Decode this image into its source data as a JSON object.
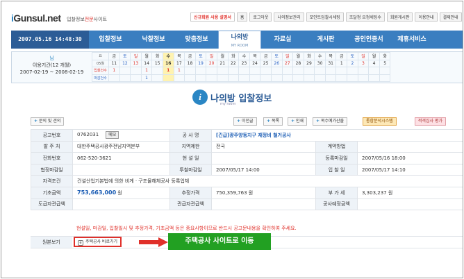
{
  "site": {
    "logo_prefix": "i",
    "logo_main": "Gunsul.net",
    "tagline_pre": "입찰정보",
    "tagline_red": "전문",
    "tagline_post": "사이트"
  },
  "toplinks": [
    "신규회원 사용 설명서",
    "홈",
    "로그아웃",
    "나의정보관리",
    "포인트입찰시세팅",
    "조달청 요청세팅수",
    "회원게시판",
    "이용안내",
    "결제안내"
  ],
  "datetime": "2007.05.16 14:48:30",
  "tabs": [
    {
      "label": "입찰정보"
    },
    {
      "label": "낙찰정보"
    },
    {
      "label": "맞춤정보"
    },
    {
      "label": "나의방",
      "sub": "MY ROOM"
    },
    {
      "label": "자료실"
    },
    {
      "label": "게시판"
    },
    {
      "label": "공인인증서"
    },
    {
      "label": "제휴서비스"
    }
  ],
  "period": {
    "line1": "님",
    "line2": "이용기간(12 개월)",
    "line3": "2007-02-19 ~ 2008-02-19"
  },
  "calendar": {
    "weekday_label": "요",
    "month_label": "05월",
    "row1_label": "입찰건수",
    "row2_label": "마감건수",
    "days": [
      {
        "w": "일",
        "d": "6"
      },
      {
        "w": "월",
        "d": "7"
      },
      {
        "w": "화",
        "d": "8"
      },
      {
        "w": "수",
        "d": "9"
      },
      {
        "w": "목",
        "d": "10"
      },
      {
        "w": "금",
        "d": "11"
      },
      {
        "w": "토",
        "d": "12"
      },
      {
        "w": "일",
        "d": "13"
      },
      {
        "w": "월",
        "d": "14"
      },
      {
        "w": "화",
        "d": "15"
      },
      {
        "w": "수",
        "d": "16"
      },
      {
        "w": "목",
        "d": "17"
      },
      {
        "w": "금",
        "d": "18"
      },
      {
        "w": "토",
        "d": "19"
      },
      {
        "w": "일",
        "d": "20"
      },
      {
        "w": "월",
        "d": "21"
      },
      {
        "w": "화",
        "d": "22"
      },
      {
        "w": "수",
        "d": "23"
      },
      {
        "w": "목",
        "d": "24"
      },
      {
        "w": "금",
        "d": "25"
      },
      {
        "w": "토",
        "d": "26"
      },
      {
        "w": "일",
        "d": "27"
      },
      {
        "w": "월",
        "d": "28"
      },
      {
        "w": "화",
        "d": "29"
      },
      {
        "w": "수",
        "d": "30"
      },
      {
        "w": "목",
        "d": "31"
      }
    ],
    "weekdays_top": [
      "금",
      "토",
      "일",
      "월",
      "화",
      "수",
      "목",
      "금",
      "토",
      "일",
      "월",
      "화",
      "수",
      "목",
      "금",
      "토",
      "일",
      "월",
      "화",
      "수",
      "목",
      "금",
      "토",
      "일",
      "월",
      "화"
    ],
    "dates_top": [
      "11",
      "12",
      "13",
      "14",
      "15",
      "16",
      "17",
      "18",
      "19",
      "20",
      "21",
      "22",
      "23",
      "24",
      "25",
      "26",
      "27",
      "28",
      "29",
      "30",
      "31",
      "1",
      "2",
      "3",
      "4",
      "5"
    ],
    "bid_counts": [
      "1",
      "",
      "",
      "1",
      "",
      "1",
      "1",
      "",
      "",
      "",
      "",
      "",
      "",
      "",
      "",
      "",
      "",
      "",
      "",
      "",
      "",
      "",
      "",
      "",
      "",
      ""
    ],
    "close_counts": [
      "",
      "",
      "",
      "1",
      "",
      "",
      "",
      "",
      "",
      "",
      "",
      "",
      "",
      "",
      "",
      "",
      "",
      "",
      "",
      "",
      "",
      "",
      "",
      "",
      "",
      ""
    ]
  },
  "page_title": {
    "main": "나의방 입찰정보",
    "sub": "my room"
  },
  "buttons": {
    "bid_record": "문의 및 견의",
    "prev": "이전글",
    "list": "목록",
    "print": "인쇄",
    "multi_calc": "복수예가산출",
    "integrated": "통합분석시스템",
    "suitability": "적격심사 평가"
  },
  "info": {
    "rows": [
      {
        "k1": "공고번호",
        "v1": "0762031",
        "memo": "메모",
        "k2": "공 사 명",
        "v2": "[긴급]광주양동지구 재정비 철거공사",
        "k3": "",
        "v3": ""
      },
      {
        "k1": "발 주 처",
        "v1": "대한주택공사광주전남지역본부",
        "k2": "지역제한",
        "v2": "전국",
        "k3": "계약방법",
        "v3": ""
      },
      {
        "k1": "전화번호",
        "v1": "062-520-3621",
        "k2": "현 설 일",
        "v2": "",
        "k3": "등록마감일",
        "v3": "2007/05/16 18:00"
      },
      {
        "k1": "협정마감일",
        "v1": "",
        "k2": "투찰마감일",
        "v2": "2007/05/17 14:00",
        "k3": "입 찰 일",
        "v3": "2007/05/17 14:10"
      },
      {
        "k1": "자격조건",
        "v1": "건설산업기본법에 의한 비계ㆍ구조물해체공사 등록업체"
      },
      {
        "k1": "기초금액",
        "v1": "753,663,000",
        "unit": "원",
        "k2": "추정가격",
        "v2": "750,359,763 원",
        "k3": "부 가 세",
        "v3": "3,303,237 원"
      },
      {
        "k1": "도급자관급액",
        "v1": "",
        "k2": "관급자관급액",
        "v2": "",
        "k3": "공사예정금액",
        "v3": ""
      }
    ]
  },
  "notice": "현설일, 마감일, 입찰일시 및 추정가격, 기초금액 등은 중요사항이므로 반드시 공고문내용을 확인하여 주세요.",
  "source": {
    "label": "원본보기",
    "btn_label": "주택공사 바로가기",
    "go_label": "주택공사 사이트로 이동"
  },
  "colors": {
    "nav_blue": "#3a7ec0",
    "accent_red": "#e0302a",
    "go_green": "#22a022"
  }
}
